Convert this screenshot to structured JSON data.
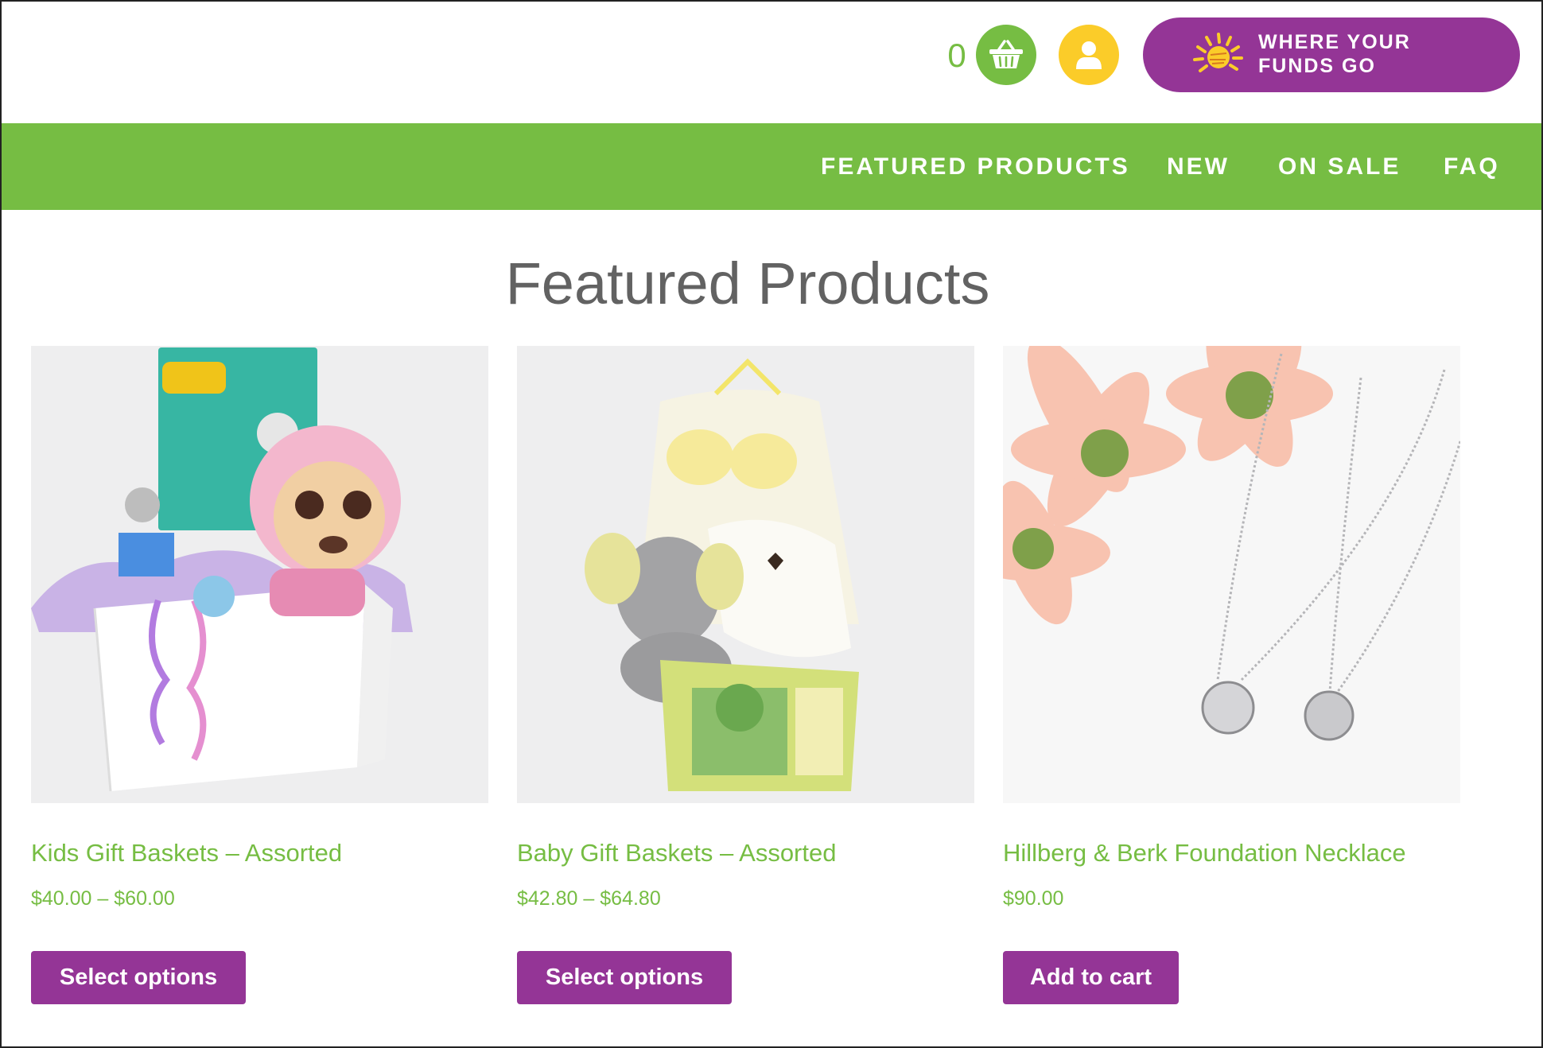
{
  "header": {
    "cart_count": "0",
    "funds_line1": "WHERE YOUR",
    "funds_line2": "FUNDS GO"
  },
  "nav": {
    "items": [
      {
        "label": "FEATURED PRODUCTS"
      },
      {
        "label": "NEW"
      },
      {
        "label": "ON SALE"
      },
      {
        "label": "FAQ"
      }
    ]
  },
  "main": {
    "title": "Featured Products",
    "products": [
      {
        "title": "Kids Gift Baskets – Assorted",
        "price": "$40.00 – $60.00",
        "button": "Select options",
        "image_icon": "kids-gift-basket-image"
      },
      {
        "title": "Baby Gift Baskets – Assorted",
        "price": "$42.80 – $64.80",
        "button": "Select options",
        "image_icon": "baby-gift-basket-image"
      },
      {
        "title": "Hillberg & Berk Foundation Necklace",
        "price": "$90.00",
        "button": "Add to cart",
        "image_icon": "necklace-image"
      }
    ]
  },
  "colors": {
    "green": "#76bd43",
    "purple": "#943596",
    "yellow": "#fbcc29",
    "title_gray": "#626262"
  }
}
